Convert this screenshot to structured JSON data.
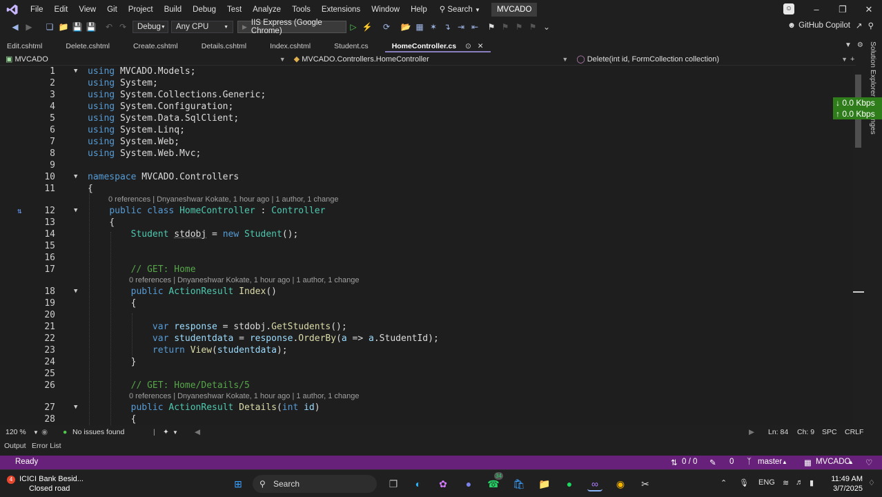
{
  "menubar": {
    "items": [
      "File",
      "Edit",
      "View",
      "Git",
      "Project",
      "Build",
      "Debug",
      "Test",
      "Analyze",
      "Tools",
      "Extensions",
      "Window",
      "Help"
    ],
    "search_label": "Search",
    "solution_name": "MVCADO"
  },
  "toolbar": {
    "config": "Debug",
    "platform": "Any CPU",
    "run_target": "IIS Express (Google Chrome)",
    "copilot_label": "GitHub Copilot"
  },
  "tabs": [
    {
      "label": "Edit.cshtml"
    },
    {
      "label": "Delete.cshtml"
    },
    {
      "label": "Create.cshtml"
    },
    {
      "label": "Details.cshtml"
    },
    {
      "label": "Index.cshtml"
    },
    {
      "label": "Student.cs"
    },
    {
      "label": "HomeController.cs",
      "active": true
    }
  ],
  "navbar": {
    "project": "MVCADO",
    "class_path": "MVCADO.Controllers.HomeController",
    "member": "Delete(int id, FormCollection collection)"
  },
  "code": {
    "lines": [
      {
        "n": "1",
        "t": "using MVCADO.Models;"
      },
      {
        "n": "2",
        "t": "using System;"
      },
      {
        "n": "3",
        "t": "using System.Collections.Generic;"
      },
      {
        "n": "4",
        "t": "using System.Configuration;"
      },
      {
        "n": "5",
        "t": "using System.Data.SqlClient;"
      },
      {
        "n": "6",
        "t": "using System.Linq;"
      },
      {
        "n": "7",
        "t": "using System.Web;"
      },
      {
        "n": "8",
        "t": "using System.Web.Mvc;"
      },
      {
        "n": "9",
        "t": ""
      },
      {
        "n": "10",
        "t": "namespace MVCADO.Controllers"
      },
      {
        "n": "11",
        "t": "{"
      },
      {
        "n": "12",
        "t": "    public class HomeController : Controller"
      },
      {
        "n": "13",
        "t": "    {"
      },
      {
        "n": "14",
        "t": "        Student stdobj = new Student();"
      },
      {
        "n": "15",
        "t": ""
      },
      {
        "n": "16",
        "t": ""
      },
      {
        "n": "17",
        "t": "        // GET: Home"
      },
      {
        "n": "18",
        "t": "        public ActionResult Index()"
      },
      {
        "n": "19",
        "t": "        {"
      },
      {
        "n": "20",
        "t": ""
      },
      {
        "n": "21",
        "t": "            var response = stdobj.GetStudents();"
      },
      {
        "n": "22",
        "t": "            var studentdata = response.OrderBy(a => a.StudentId);"
      },
      {
        "n": "23",
        "t": "            return View(studentdata);"
      },
      {
        "n": "24",
        "t": "        }"
      },
      {
        "n": "25",
        "t": ""
      },
      {
        "n": "26",
        "t": "        // GET: Home/Details/5"
      },
      {
        "n": "27",
        "t": "        public ActionResult Details(int id)"
      },
      {
        "n": "28",
        "t": "        {"
      }
    ],
    "lens_class": "0 references | Dnyaneshwar Kokate, 1 hour ago | 1 author, 1 change",
    "lens_index": "0 references | Dnyaneshwar Kokate, 1 hour ago | 1 author, 1 change",
    "lens_details": "0 references | Dnyaneshwar Kokate, 1 hour ago | 1 author, 1 change"
  },
  "sidepane": {
    "solution_explorer": "Solution Explorer",
    "changes": "nges"
  },
  "netspeed": {
    "down": "↓ 0.0 Kbps",
    "up": "↑ 0.0 Kbps"
  },
  "editor_status": {
    "zoom": "120 %",
    "issues": "No issues found",
    "ln": "Ln: 84",
    "ch": "Ch: 9",
    "spc": "SPC",
    "eol": "CRLF"
  },
  "output_tabs": {
    "output": "Output",
    "errors": "Error List"
  },
  "statusbar": {
    "ready": "Ready",
    "changes": "0 / 0",
    "edits": "0",
    "branch": "master",
    "repo": "MVCADO"
  },
  "taskbar": {
    "news_title": "ICICI Bank Besid...",
    "news_sub": "Closed road",
    "news_badge": "4",
    "search_label": "Search",
    "whatsapp_badge": "34",
    "lang": "ENG",
    "time": "11:49 AM",
    "date": "3/7/2025"
  },
  "colors": {
    "status_bar": "#68217a",
    "accent": "#8a7ec0",
    "net_badge": "#2e7d1a"
  }
}
